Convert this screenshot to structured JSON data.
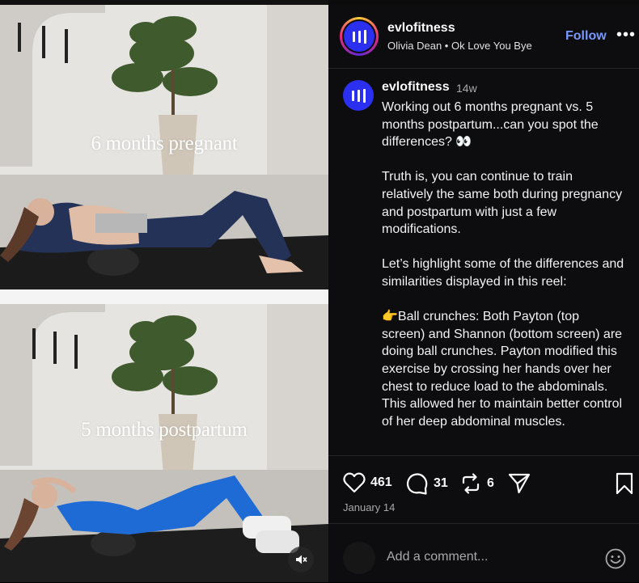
{
  "media": {
    "top_caption": "6 months pregnant",
    "bottom_caption": "5 months postpartum",
    "mute_icon": "speaker-muted-icon"
  },
  "header": {
    "username": "evlofitness",
    "audio": "Olivia Dean • Ok Love You Bye",
    "follow_label": "Follow",
    "more_label": "•••"
  },
  "caption": {
    "username": "evlofitness",
    "time": "14w",
    "paragraphs": [
      "Working out 6 months pregnant vs. 5 months postpartum...can you spot the differences? 👀",
      "Truth is, you can continue to train relatively the same both during pregnancy and postpartum with just a few modifications.",
      "Let’s highlight some of the differences and similarities displayed in this reel:",
      "👉Ball crunches: Both Payton (top screen) and Shannon (bottom screen) are doing ball crunches. Payton modified this exercise by crossing her hands over her chest to reduce load to the abdominals. This allowed her to maintain better control of her deep abdominal muscles."
    ]
  },
  "actions": {
    "likes": "461",
    "comments": "31",
    "reposts": "6",
    "date": "January 14"
  },
  "comment_box": {
    "placeholder": "Add a comment..."
  },
  "colors": {
    "accent": "#7898ff",
    "avatar_blue": "#2b2ff0",
    "panel_bg": "#0d0d0f"
  }
}
